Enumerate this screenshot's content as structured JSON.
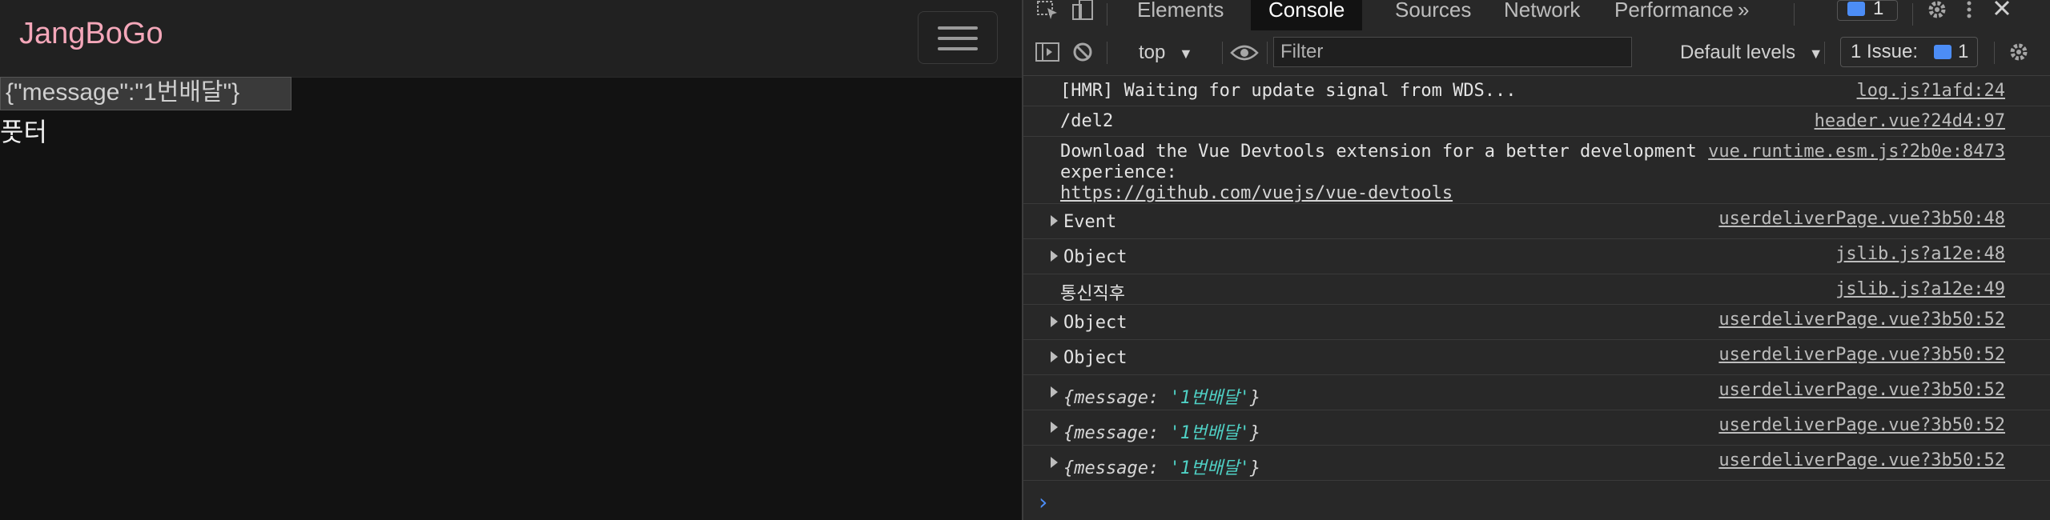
{
  "app": {
    "brand": "JangBoGo",
    "message_box": "{\"message\":\"1번배달\"}",
    "footer_text": "풋터"
  },
  "devtools": {
    "tabs": [
      "Elements",
      "Console",
      "Sources",
      "Network",
      "Performance"
    ],
    "active_tab": "Console",
    "more_tabs_icon": "»",
    "messages_badge_count": "1",
    "toolbar": {
      "context": "top",
      "filter_placeholder": "Filter",
      "levels": "Default levels",
      "issues_label": "1 Issue:",
      "issues_count": "1"
    },
    "console_rows": [
      {
        "text": "[HMR] Waiting for update signal from WDS...",
        "source": "log.js?1afd:24"
      },
      {
        "text": "/del2",
        "source": "header.vue?24d4:97"
      },
      {
        "text_line1": "Download the Vue Devtools extension for a better development",
        "text_line2": "experience:",
        "link": "https://github.com/vuejs/vue-devtools",
        "source": "vue.runtime.esm.js?2b0e:8473"
      },
      {
        "text": "Event",
        "source": "userdeliverPage.vue?3b50:48"
      },
      {
        "text": "Object",
        "source": "jslib.js?a12e:48"
      },
      {
        "text": "통신직후",
        "source": "jslib.js?a12e:49"
      },
      {
        "text": "Object",
        "source": "userdeliverPage.vue?3b50:52"
      },
      {
        "text": "Object",
        "source": "userdeliverPage.vue?3b50:52"
      },
      {
        "key": "{message: ",
        "value": "'1번배달'",
        "close": "}",
        "source": "userdeliverPage.vue?3b50:52"
      },
      {
        "key": "{message: ",
        "value": "'1번배달'",
        "close": "}",
        "source": "userdeliverPage.vue?3b50:52"
      },
      {
        "key": "{message: ",
        "value": "'1번배달'",
        "close": "}",
        "source": "userdeliverPage.vue?3b50:52"
      }
    ],
    "prompt": "›"
  },
  "colors": {
    "brand": "#f4a7b9",
    "accent_blue": "#4c8df6",
    "string_teal": "#4fd1c5"
  }
}
